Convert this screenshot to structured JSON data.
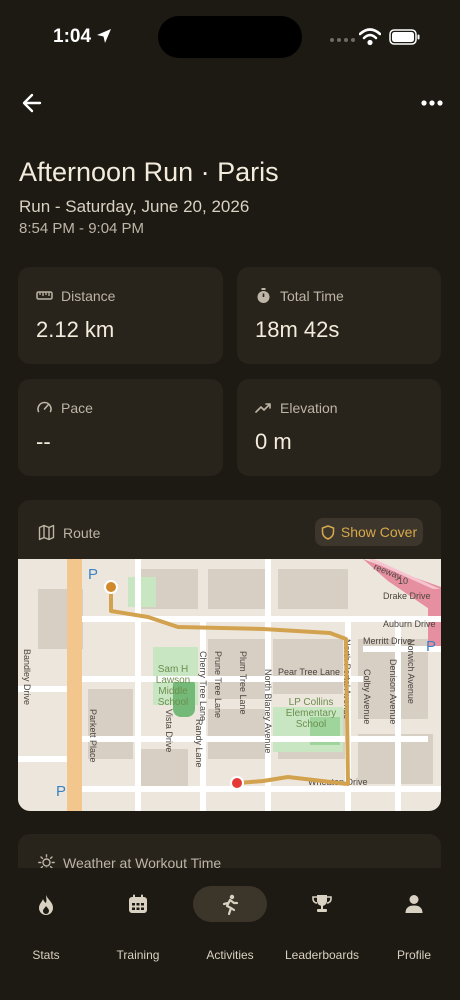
{
  "status_bar": {
    "time": "1:04"
  },
  "header": {
    "back_icon": "arrow-left-icon",
    "more_icon": "more-horizontal-icon"
  },
  "activity": {
    "title": "Afternoon Run · Paris",
    "subtitle": "Run - Saturday, June 20, 2026",
    "time_range": "8:54 PM - 9:04 PM"
  },
  "stats": {
    "distance": {
      "label": "Distance",
      "value": "2.12 km",
      "icon": "ruler-icon"
    },
    "total_time": {
      "label": "Total Time",
      "value": "18m 42s",
      "icon": "stopwatch-icon"
    },
    "pace": {
      "label": "Pace",
      "value": "--",
      "icon": "gauge-icon"
    },
    "elevation": {
      "label": "Elevation",
      "value": "0 m",
      "icon": "trending-up-icon"
    }
  },
  "route": {
    "label": "Route",
    "show_cover_label": "Show Cover",
    "route_color": "#d3a24f",
    "start_color": "#d08a2c",
    "end_color": "#e53935",
    "map_labels": {
      "school1": [
        "Sam H",
        "Lawson",
        "Middle",
        "School"
      ],
      "school2": [
        "LP Collins",
        "Elementary",
        "School"
      ],
      "streets": {
        "drake": "Drake Drive",
        "auburn": "Auburn Drive",
        "merritt": "Merritt Drive",
        "pear": "Pear Tree Lane",
        "wheaton": "Wheaton Drive",
        "plum": "Plum Tree Lane",
        "prune": "Prune Tree Lane",
        "cherry": "Cherry Tree Lane",
        "bandley": "Bandley Drive",
        "parkett": "Parkett Place",
        "vista": "Vista Drive",
        "randy": "Randy Lane",
        "blaney": "North Blaney Avenue",
        "portal": "North Portal Avenue",
        "colby": "Colby Avenue",
        "denison": "Denison Avenue",
        "norwich": "Norwich Avenue",
        "freeway": "reeway",
        "shield": "10"
      }
    }
  },
  "weather": {
    "label": "Weather at Workout Time"
  },
  "tabs": [
    {
      "label": "Stats",
      "icon": "flame-icon"
    },
    {
      "label": "Training",
      "icon": "calendar-icon"
    },
    {
      "label": "Activities",
      "icon": "running-icon"
    },
    {
      "label": "Leaderboards",
      "icon": "trophy-icon"
    },
    {
      "label": "Profile",
      "icon": "person-icon"
    }
  ],
  "active_tab": "Activities"
}
